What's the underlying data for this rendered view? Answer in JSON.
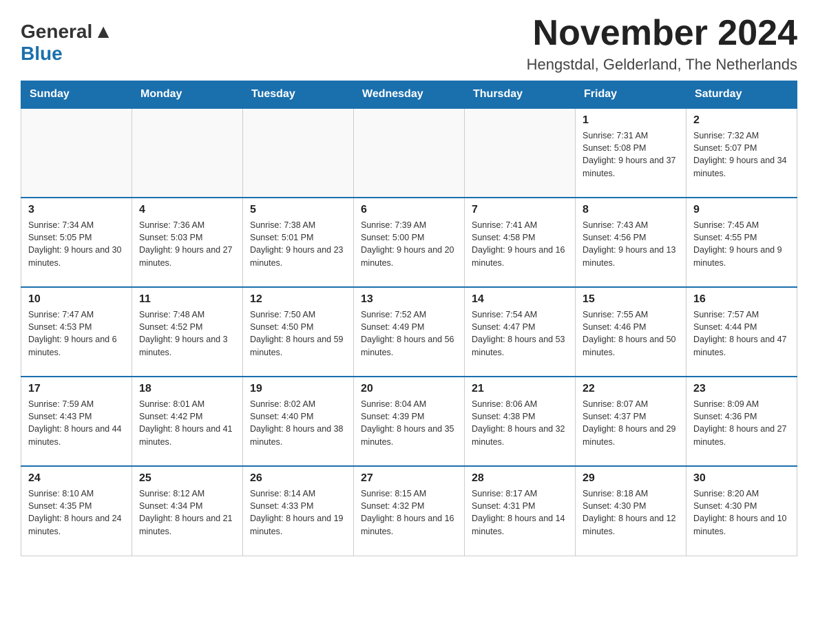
{
  "logo": {
    "general": "General",
    "blue": "Blue"
  },
  "title": "November 2024",
  "location": "Hengstdal, Gelderland, The Netherlands",
  "days_of_week": [
    "Sunday",
    "Monday",
    "Tuesday",
    "Wednesday",
    "Thursday",
    "Friday",
    "Saturday"
  ],
  "weeks": [
    [
      {
        "day": "",
        "info": ""
      },
      {
        "day": "",
        "info": ""
      },
      {
        "day": "",
        "info": ""
      },
      {
        "day": "",
        "info": ""
      },
      {
        "day": "",
        "info": ""
      },
      {
        "day": "1",
        "info": "Sunrise: 7:31 AM\nSunset: 5:08 PM\nDaylight: 9 hours and 37 minutes."
      },
      {
        "day": "2",
        "info": "Sunrise: 7:32 AM\nSunset: 5:07 PM\nDaylight: 9 hours and 34 minutes."
      }
    ],
    [
      {
        "day": "3",
        "info": "Sunrise: 7:34 AM\nSunset: 5:05 PM\nDaylight: 9 hours and 30 minutes."
      },
      {
        "day": "4",
        "info": "Sunrise: 7:36 AM\nSunset: 5:03 PM\nDaylight: 9 hours and 27 minutes."
      },
      {
        "day": "5",
        "info": "Sunrise: 7:38 AM\nSunset: 5:01 PM\nDaylight: 9 hours and 23 minutes."
      },
      {
        "day": "6",
        "info": "Sunrise: 7:39 AM\nSunset: 5:00 PM\nDaylight: 9 hours and 20 minutes."
      },
      {
        "day": "7",
        "info": "Sunrise: 7:41 AM\nSunset: 4:58 PM\nDaylight: 9 hours and 16 minutes."
      },
      {
        "day": "8",
        "info": "Sunrise: 7:43 AM\nSunset: 4:56 PM\nDaylight: 9 hours and 13 minutes."
      },
      {
        "day": "9",
        "info": "Sunrise: 7:45 AM\nSunset: 4:55 PM\nDaylight: 9 hours and 9 minutes."
      }
    ],
    [
      {
        "day": "10",
        "info": "Sunrise: 7:47 AM\nSunset: 4:53 PM\nDaylight: 9 hours and 6 minutes."
      },
      {
        "day": "11",
        "info": "Sunrise: 7:48 AM\nSunset: 4:52 PM\nDaylight: 9 hours and 3 minutes."
      },
      {
        "day": "12",
        "info": "Sunrise: 7:50 AM\nSunset: 4:50 PM\nDaylight: 8 hours and 59 minutes."
      },
      {
        "day": "13",
        "info": "Sunrise: 7:52 AM\nSunset: 4:49 PM\nDaylight: 8 hours and 56 minutes."
      },
      {
        "day": "14",
        "info": "Sunrise: 7:54 AM\nSunset: 4:47 PM\nDaylight: 8 hours and 53 minutes."
      },
      {
        "day": "15",
        "info": "Sunrise: 7:55 AM\nSunset: 4:46 PM\nDaylight: 8 hours and 50 minutes."
      },
      {
        "day": "16",
        "info": "Sunrise: 7:57 AM\nSunset: 4:44 PM\nDaylight: 8 hours and 47 minutes."
      }
    ],
    [
      {
        "day": "17",
        "info": "Sunrise: 7:59 AM\nSunset: 4:43 PM\nDaylight: 8 hours and 44 minutes."
      },
      {
        "day": "18",
        "info": "Sunrise: 8:01 AM\nSunset: 4:42 PM\nDaylight: 8 hours and 41 minutes."
      },
      {
        "day": "19",
        "info": "Sunrise: 8:02 AM\nSunset: 4:40 PM\nDaylight: 8 hours and 38 minutes."
      },
      {
        "day": "20",
        "info": "Sunrise: 8:04 AM\nSunset: 4:39 PM\nDaylight: 8 hours and 35 minutes."
      },
      {
        "day": "21",
        "info": "Sunrise: 8:06 AM\nSunset: 4:38 PM\nDaylight: 8 hours and 32 minutes."
      },
      {
        "day": "22",
        "info": "Sunrise: 8:07 AM\nSunset: 4:37 PM\nDaylight: 8 hours and 29 minutes."
      },
      {
        "day": "23",
        "info": "Sunrise: 8:09 AM\nSunset: 4:36 PM\nDaylight: 8 hours and 27 minutes."
      }
    ],
    [
      {
        "day": "24",
        "info": "Sunrise: 8:10 AM\nSunset: 4:35 PM\nDaylight: 8 hours and 24 minutes."
      },
      {
        "day": "25",
        "info": "Sunrise: 8:12 AM\nSunset: 4:34 PM\nDaylight: 8 hours and 21 minutes."
      },
      {
        "day": "26",
        "info": "Sunrise: 8:14 AM\nSunset: 4:33 PM\nDaylight: 8 hours and 19 minutes."
      },
      {
        "day": "27",
        "info": "Sunrise: 8:15 AM\nSunset: 4:32 PM\nDaylight: 8 hours and 16 minutes."
      },
      {
        "day": "28",
        "info": "Sunrise: 8:17 AM\nSunset: 4:31 PM\nDaylight: 8 hours and 14 minutes."
      },
      {
        "day": "29",
        "info": "Sunrise: 8:18 AM\nSunset: 4:30 PM\nDaylight: 8 hours and 12 minutes."
      },
      {
        "day": "30",
        "info": "Sunrise: 8:20 AM\nSunset: 4:30 PM\nDaylight: 8 hours and 10 minutes."
      }
    ]
  ]
}
